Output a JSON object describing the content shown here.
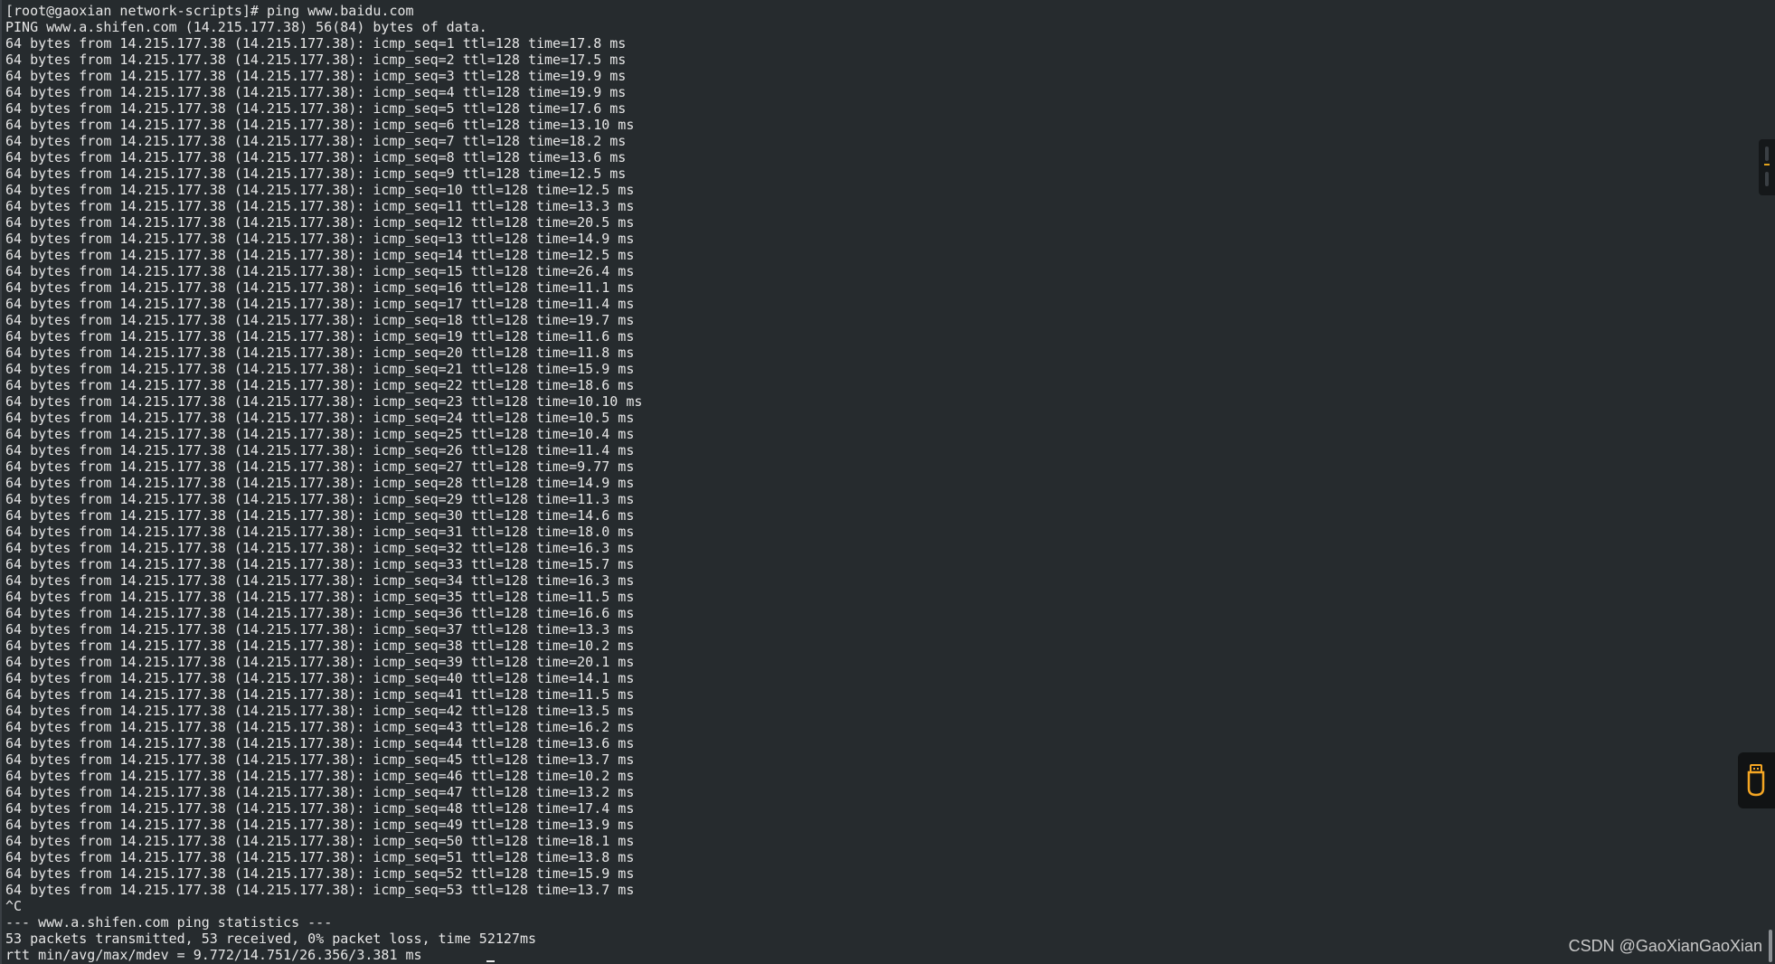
{
  "terminal": {
    "lines": [
      "[root@gaoxian network-scripts]# ping www.baidu.com",
      "PING www.a.shifen.com (14.215.177.38) 56(84) bytes of data.",
      "64 bytes from 14.215.177.38 (14.215.177.38): icmp_seq=1 ttl=128 time=17.8 ms",
      "64 bytes from 14.215.177.38 (14.215.177.38): icmp_seq=2 ttl=128 time=17.5 ms",
      "64 bytes from 14.215.177.38 (14.215.177.38): icmp_seq=3 ttl=128 time=19.9 ms",
      "64 bytes from 14.215.177.38 (14.215.177.38): icmp_seq=4 ttl=128 time=19.9 ms",
      "64 bytes from 14.215.177.38 (14.215.177.38): icmp_seq=5 ttl=128 time=17.6 ms",
      "64 bytes from 14.215.177.38 (14.215.177.38): icmp_seq=6 ttl=128 time=13.10 ms",
      "64 bytes from 14.215.177.38 (14.215.177.38): icmp_seq=7 ttl=128 time=18.2 ms",
      "64 bytes from 14.215.177.38 (14.215.177.38): icmp_seq=8 ttl=128 time=13.6 ms",
      "64 bytes from 14.215.177.38 (14.215.177.38): icmp_seq=9 ttl=128 time=12.5 ms",
      "64 bytes from 14.215.177.38 (14.215.177.38): icmp_seq=10 ttl=128 time=12.5 ms",
      "64 bytes from 14.215.177.38 (14.215.177.38): icmp_seq=11 ttl=128 time=13.3 ms",
      "64 bytes from 14.215.177.38 (14.215.177.38): icmp_seq=12 ttl=128 time=20.5 ms",
      "64 bytes from 14.215.177.38 (14.215.177.38): icmp_seq=13 ttl=128 time=14.9 ms",
      "64 bytes from 14.215.177.38 (14.215.177.38): icmp_seq=14 ttl=128 time=12.5 ms",
      "64 bytes from 14.215.177.38 (14.215.177.38): icmp_seq=15 ttl=128 time=26.4 ms",
      "64 bytes from 14.215.177.38 (14.215.177.38): icmp_seq=16 ttl=128 time=11.1 ms",
      "64 bytes from 14.215.177.38 (14.215.177.38): icmp_seq=17 ttl=128 time=11.4 ms",
      "64 bytes from 14.215.177.38 (14.215.177.38): icmp_seq=18 ttl=128 time=19.7 ms",
      "64 bytes from 14.215.177.38 (14.215.177.38): icmp_seq=19 ttl=128 time=11.6 ms",
      "64 bytes from 14.215.177.38 (14.215.177.38): icmp_seq=20 ttl=128 time=11.8 ms",
      "64 bytes from 14.215.177.38 (14.215.177.38): icmp_seq=21 ttl=128 time=15.9 ms",
      "64 bytes from 14.215.177.38 (14.215.177.38): icmp_seq=22 ttl=128 time=18.6 ms",
      "64 bytes from 14.215.177.38 (14.215.177.38): icmp_seq=23 ttl=128 time=10.10 ms",
      "64 bytes from 14.215.177.38 (14.215.177.38): icmp_seq=24 ttl=128 time=10.5 ms",
      "64 bytes from 14.215.177.38 (14.215.177.38): icmp_seq=25 ttl=128 time=10.4 ms",
      "64 bytes from 14.215.177.38 (14.215.177.38): icmp_seq=26 ttl=128 time=11.4 ms",
      "64 bytes from 14.215.177.38 (14.215.177.38): icmp_seq=27 ttl=128 time=9.77 ms",
      "64 bytes from 14.215.177.38 (14.215.177.38): icmp_seq=28 ttl=128 time=14.9 ms",
      "64 bytes from 14.215.177.38 (14.215.177.38): icmp_seq=29 ttl=128 time=11.3 ms",
      "64 bytes from 14.215.177.38 (14.215.177.38): icmp_seq=30 ttl=128 time=14.6 ms",
      "64 bytes from 14.215.177.38 (14.215.177.38): icmp_seq=31 ttl=128 time=18.0 ms",
      "64 bytes from 14.215.177.38 (14.215.177.38): icmp_seq=32 ttl=128 time=16.3 ms",
      "64 bytes from 14.215.177.38 (14.215.177.38): icmp_seq=33 ttl=128 time=15.7 ms",
      "64 bytes from 14.215.177.38 (14.215.177.38): icmp_seq=34 ttl=128 time=16.3 ms",
      "64 bytes from 14.215.177.38 (14.215.177.38): icmp_seq=35 ttl=128 time=11.5 ms",
      "64 bytes from 14.215.177.38 (14.215.177.38): icmp_seq=36 ttl=128 time=16.6 ms",
      "64 bytes from 14.215.177.38 (14.215.177.38): icmp_seq=37 ttl=128 time=13.3 ms",
      "64 bytes from 14.215.177.38 (14.215.177.38): icmp_seq=38 ttl=128 time=10.2 ms",
      "64 bytes from 14.215.177.38 (14.215.177.38): icmp_seq=39 ttl=128 time=20.1 ms",
      "64 bytes from 14.215.177.38 (14.215.177.38): icmp_seq=40 ttl=128 time=14.1 ms",
      "64 bytes from 14.215.177.38 (14.215.177.38): icmp_seq=41 ttl=128 time=11.5 ms",
      "64 bytes from 14.215.177.38 (14.215.177.38): icmp_seq=42 ttl=128 time=13.5 ms",
      "64 bytes from 14.215.177.38 (14.215.177.38): icmp_seq=43 ttl=128 time=16.2 ms",
      "64 bytes from 14.215.177.38 (14.215.177.38): icmp_seq=44 ttl=128 time=13.6 ms",
      "64 bytes from 14.215.177.38 (14.215.177.38): icmp_seq=45 ttl=128 time=13.7 ms",
      "64 bytes from 14.215.177.38 (14.215.177.38): icmp_seq=46 ttl=128 time=10.2 ms",
      "64 bytes from 14.215.177.38 (14.215.177.38): icmp_seq=47 ttl=128 time=13.2 ms",
      "64 bytes from 14.215.177.38 (14.215.177.38): icmp_seq=48 ttl=128 time=17.4 ms",
      "64 bytes from 14.215.177.38 (14.215.177.38): icmp_seq=49 ttl=128 time=13.9 ms",
      "64 bytes from 14.215.177.38 (14.215.177.38): icmp_seq=50 ttl=128 time=18.1 ms",
      "64 bytes from 14.215.177.38 (14.215.177.38): icmp_seq=51 ttl=128 time=13.8 ms",
      "64 bytes from 14.215.177.38 (14.215.177.38): icmp_seq=52 ttl=128 time=15.9 ms",
      "64 bytes from 14.215.177.38 (14.215.177.38): icmp_seq=53 ttl=128 time=13.7 ms",
      "^C",
      "--- www.a.shifen.com ping statistics ---",
      "53 packets transmitted, 53 received, 0% packet loss, time 52127ms",
      "rtt min/avg/max/mdev = 9.772/14.751/26.356/3.381 ms"
    ],
    "background_color": "#262b2e",
    "text_color": "#e6e6e6"
  },
  "side_toolbar": {
    "accent_color": "#e0a21c"
  },
  "usb_widget": {
    "icon": "usb-drive-icon",
    "color": "#f5a623"
  },
  "watermark": {
    "text": "CSDN @GaoXianGaoXian"
  }
}
